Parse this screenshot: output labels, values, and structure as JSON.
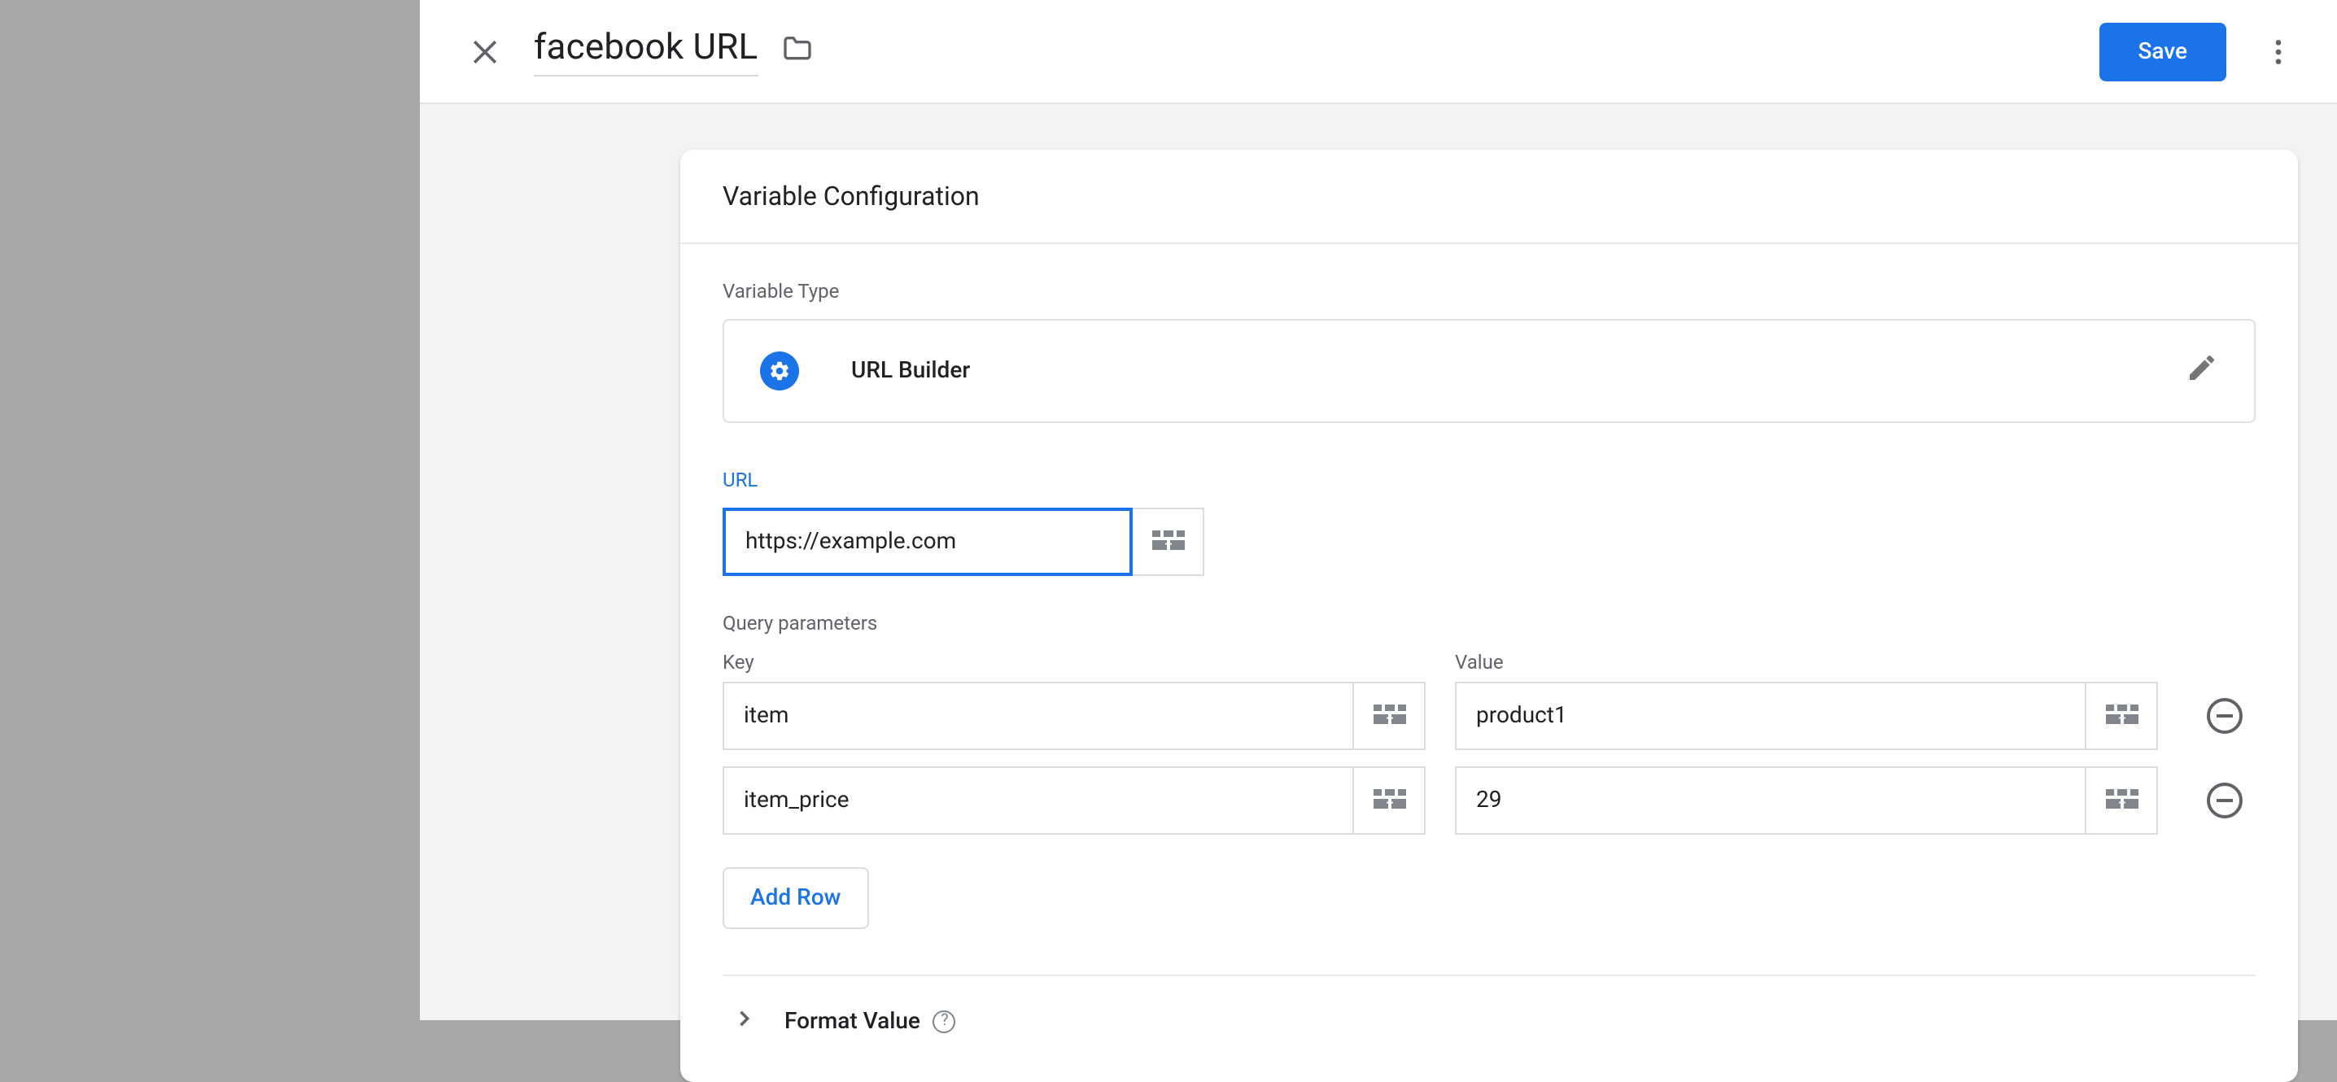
{
  "header": {
    "title": "facebook URL",
    "save_label": "Save"
  },
  "card": {
    "title": "Variable Configuration",
    "type_label": "Variable Type",
    "type_name": "URL Builder",
    "url_label": "URL",
    "url_value": "https://example.com",
    "params_label": "Query parameters",
    "key_label": "Key",
    "value_label": "Value",
    "params": [
      {
        "key": "item",
        "value": "product1"
      },
      {
        "key": "item_price",
        "value": "29"
      }
    ],
    "add_row_label": "Add Row",
    "format_label": "Format Value"
  }
}
